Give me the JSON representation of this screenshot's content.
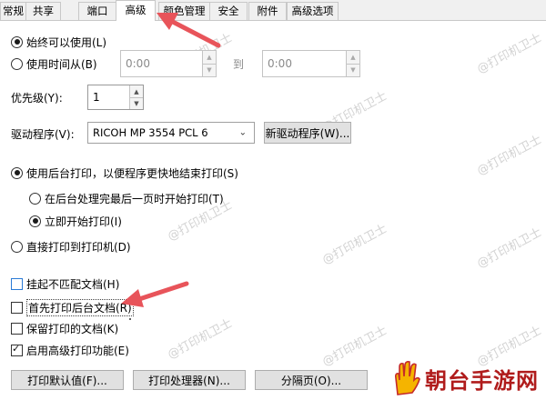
{
  "tabs": [
    "常规",
    "共享",
    "端口",
    "高级",
    "颜色管理",
    "安全",
    "附件",
    "高级选项"
  ],
  "active_tab_index": 3,
  "availability": {
    "always_label": "始终可以使用(L)",
    "from_label": "使用时间从(B)",
    "from_time": "0:00",
    "to_label": "到",
    "to_time": "0:00",
    "selected": "always"
  },
  "priority": {
    "label": "优先级(Y):",
    "value": "1"
  },
  "driver": {
    "label": "驱动程序(V):",
    "value": "RICOH MP 3554 PCL 6",
    "new_driver_button": "新驱动程序(W)..."
  },
  "spooling": {
    "spool_label": "使用后台打印，以便程序更快地结束打印(S)",
    "after_last_page_label": "在后台处理完最后一页时开始打印(T)",
    "immediately_label": "立即开始打印(I)",
    "direct_label": "直接打印到打印机(D)",
    "mode": "spool",
    "start": "immediately"
  },
  "options": [
    {
      "label": "挂起不匹配文档(H)",
      "checked": false
    },
    {
      "label": "首先打印后台文档(R)",
      "checked": false
    },
    {
      "label": "保留打印的文档(K)",
      "checked": false
    },
    {
      "label": "启用高级打印功能(E)",
      "checked": true
    }
  ],
  "buttons": {
    "defaults": "打印默认值(F)...",
    "processor": "打印处理器(N)...",
    "separator": "分隔页(O)..."
  },
  "watermark": "@打印机卫士",
  "logo_text": "朝台手游网",
  "colors": {
    "arrow": "#e8545a",
    "logo_red": "#b01c1c",
    "logo_gold": "#f5b400"
  }
}
